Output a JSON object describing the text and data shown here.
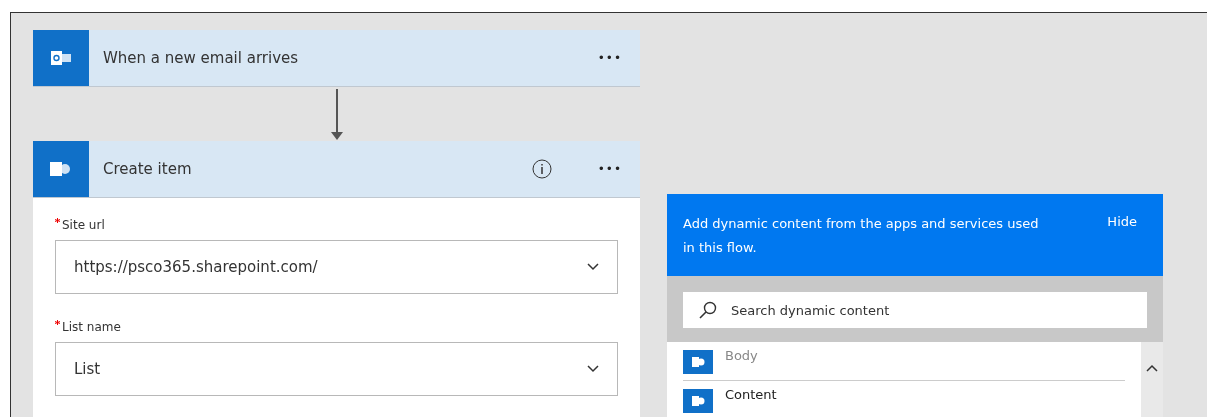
{
  "trigger": {
    "title": "When a new email arrives",
    "menu": "•••"
  },
  "action": {
    "title": "Create item",
    "menu": "•••",
    "fields": [
      {
        "label": "Site url",
        "required": true,
        "value": "https://psco365.sharepoint.com/"
      },
      {
        "label": "List name",
        "required": true,
        "value": "List"
      }
    ]
  },
  "dynamic_panel": {
    "message": "Add dynamic content from the apps and services used in this flow.",
    "hide": "Hide",
    "search": {
      "placeholder": "Search dynamic content"
    },
    "items": [
      {
        "subtitle": "Body"
      },
      {
        "title": "Content"
      }
    ]
  }
}
